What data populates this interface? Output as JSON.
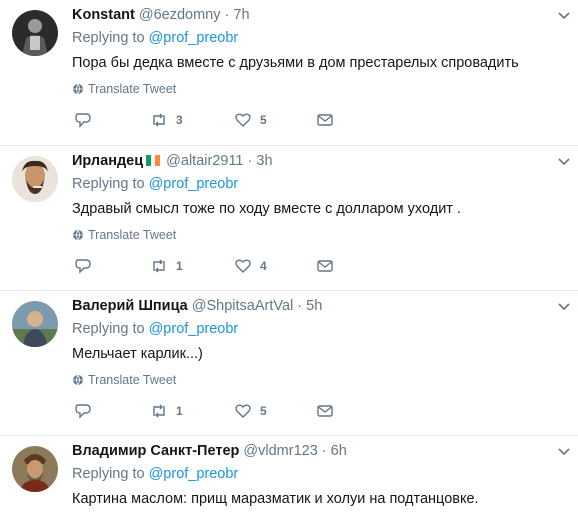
{
  "tweets": [
    {
      "name": "Konstant",
      "handle": "@6ezdomny",
      "separator": "·",
      "time": "7h",
      "replying_prefix": "Replying to",
      "replying_to": "@prof_preobr",
      "text": "Пора бы дедка вместе с друзьями в дом престарелых спровадить",
      "translate_label": "Translate Tweet",
      "retweets": "3",
      "likes": "5",
      "avatar_icon": "dark-figure-avatar"
    },
    {
      "name": "Ирландец",
      "flag": [
        "#169b62",
        "#ffffff",
        "#ff883e"
      ],
      "handle": "@altair2911",
      "separator": "·",
      "time": "3h",
      "replying_prefix": "Replying to",
      "replying_to": "@prof_preobr",
      "text": "Здравый смысл тоже по ходу вместе с долларом уходит .",
      "translate_label": "Translate Tweet",
      "retweets": "1",
      "likes": "4",
      "avatar_icon": "bearded-man-avatar"
    },
    {
      "name": "Валерий Шпица",
      "handle": "@ShpitsaArtVal",
      "separator": "·",
      "time": "5h",
      "replying_prefix": "Replying to",
      "replying_to": "@prof_preobr",
      "text": "Мельчает карлик...)",
      "translate_label": "Translate Tweet",
      "retweets": "1",
      "likes": "5",
      "avatar_icon": "man-outdoors-avatar"
    },
    {
      "name": "Владимир Санкт-Петер",
      "handle": "@vldmr123",
      "separator": "·",
      "time": "6h",
      "replying_prefix": "Replying to",
      "replying_to": "@prof_preobr",
      "text": "Картина маслом: прищ маразматик и холуи на подтанцовке.",
      "avatar_icon": "painted-portrait-avatar"
    }
  ],
  "colors": {
    "link": "#1b95e0",
    "muted": "#657786",
    "divider": "#e6ecf0"
  }
}
